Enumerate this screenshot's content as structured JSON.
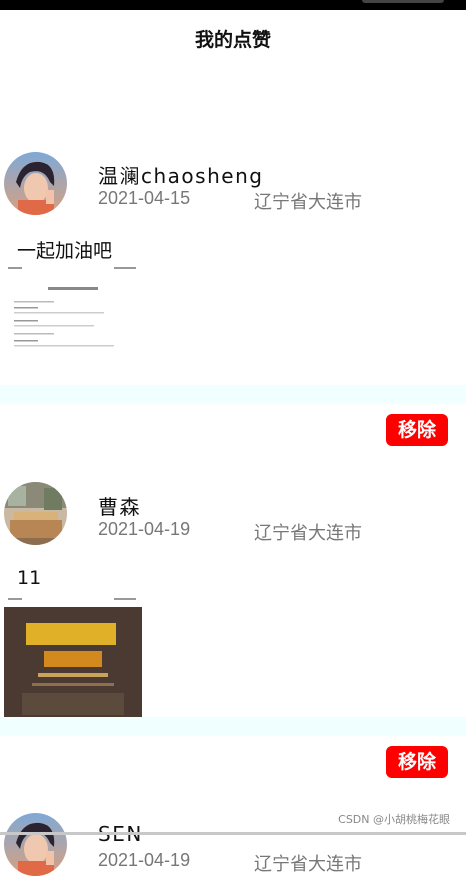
{
  "page": {
    "title": "我的点赞"
  },
  "posts": [
    {
      "username": "温澜chaosheng",
      "date": "2021-04-15",
      "location": "辽宁省大连市",
      "content": "一起加油吧",
      "remove_label": "移除",
      "avatar_icon": "avatar-portrait-icon",
      "thumb_icon": "document-screenshot-icon"
    },
    {
      "username": "曹森",
      "date": "2021-04-19",
      "location": "辽宁省大连市",
      "content": "11",
      "remove_label": "移除",
      "avatar_icon": "avatar-room-icon",
      "thumb_icon": "poster-screenshot-icon"
    },
    {
      "username": "SEN",
      "date": "2021-04-19",
      "location": "辽宁省大连市",
      "avatar_icon": "avatar-portrait-icon"
    }
  ],
  "footer": {
    "watermark": "CSDN @小胡桃梅花眼"
  },
  "colors": {
    "remove_button": "#ff0000",
    "separator": "#f0ffff",
    "meta_text": "#777777"
  }
}
